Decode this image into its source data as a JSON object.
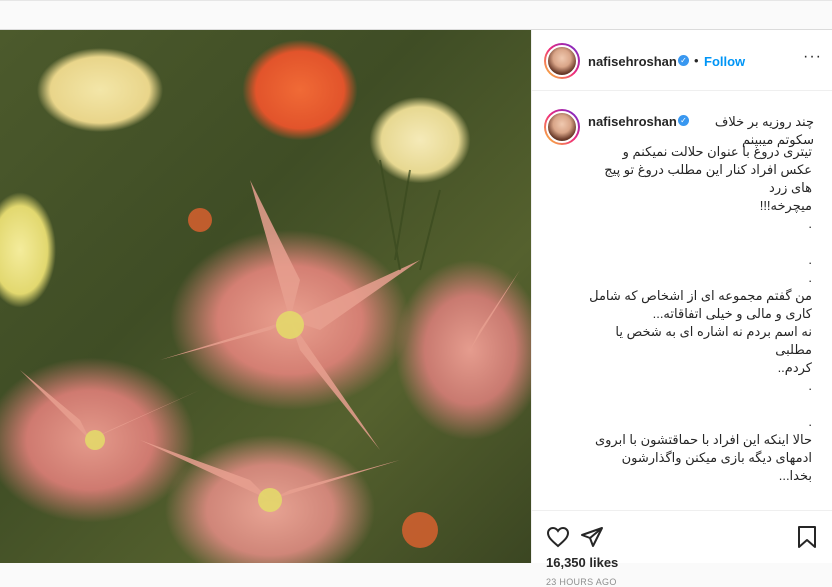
{
  "post": {
    "username": "nafisehroshan",
    "verified_icon": "verified-badge-icon",
    "follow_label": "Follow",
    "dot": "•",
    "more_label": "···",
    "caption_first": "چند روزیه بر خلاف سکوتم میبینم",
    "caption_rest": "تیتری دروغ با عنوان حلالت نمیکنم و عکس افراد کنار این مطلب دروغ تو پیج های زرد\nمیچرخه!!!\n.\n\n.\n.\nمن گفتم مجموعه ای از اشخاص که شامل کاری و مالی و خیلی اتفاقاته...\nنه اسم بردم نه اشاره ای به شخص یا مطلبی\nکردم..\n.\n\n.\nحالا اینکه این افراد با حماقتشون با ابروی ادمهای دیگه بازی میکنن واگذارشون\nبخدا...",
    "likes": "16,350 likes",
    "time": "23 HOURS AGO"
  },
  "icons": {
    "like": "heart-icon",
    "share": "send-icon",
    "save": "bookmark-icon"
  },
  "colors": {
    "link_blue": "#0095f6",
    "verified_blue": "#3897f0",
    "text": "#262626",
    "muted": "#8e8e8e"
  }
}
